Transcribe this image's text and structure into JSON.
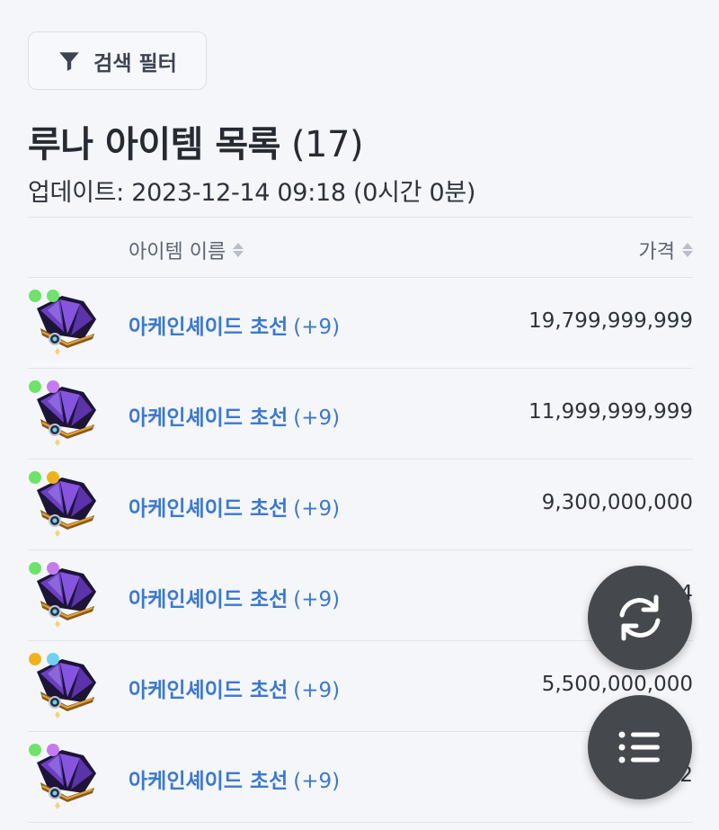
{
  "filter": {
    "label": "검색 필터",
    "icon": "filter-icon"
  },
  "header": {
    "title": "루나 아이템 목록",
    "count": "(17)",
    "updated": "업데이트: 2023-12-14 09:18 (0시간 0분)"
  },
  "table": {
    "columns": {
      "name": "아이템 이름",
      "price": "가격"
    },
    "rows": [
      {
        "name": "아케인셰이드 초선",
        "level": "(+9)",
        "price": "19,799,999,999",
        "gems": [
          "#6fe26a",
          "#6fe26a"
        ]
      },
      {
        "name": "아케인셰이드 초선",
        "level": "(+9)",
        "price": "11,999,999,999",
        "gems": [
          "#6fe26a",
          "#c57bf0"
        ]
      },
      {
        "name": "아케인셰이드 초선",
        "level": "(+9)",
        "price": "9,300,000,000",
        "gems": [
          "#6fe26a",
          "#f0b21c"
        ]
      },
      {
        "name": "아케인셰이드 초선",
        "level": "(+9)",
        "price": "6,44",
        "gems": [
          "#6fe26a",
          "#c57bf0"
        ]
      },
      {
        "name": "아케인셰이드 초선",
        "level": "(+9)",
        "price": "5,500,000,000",
        "gems": [
          "#f0b21c",
          "#6fd0f0"
        ]
      },
      {
        "name": "아케인셰이드 초선",
        "level": "(+9)",
        "price": "5,222",
        "gems": [
          "#6fe26a",
          "#c57bf0"
        ]
      }
    ]
  },
  "fabs": {
    "refresh_icon": "refresh-icon",
    "menu_icon": "list-menu-icon"
  },
  "colors": {
    "accent": "#3b78d2",
    "fab": "#45484d",
    "background": "#f5f6fa"
  }
}
